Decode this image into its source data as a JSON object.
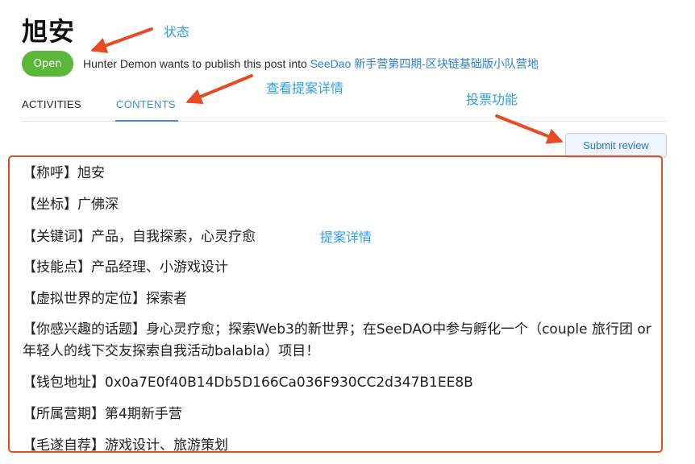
{
  "proposal": {
    "title": "旭安",
    "status": "Open",
    "author": "Hunter Demon",
    "publish_phrase": " wants to publish this post into ",
    "target": "SeeDao 新手营第四期-区块链基础版小队营地"
  },
  "tabs": [
    {
      "label": "ACTIVITIES",
      "active": false
    },
    {
      "label": "CONTENTS",
      "active": true
    }
  ],
  "actions": {
    "submit_review": "Submit review"
  },
  "content": {
    "fields": [
      "【称呼】旭安",
      "【坐标】广佛深",
      "【关键词】产品，自我探索，心灵疗愈",
      "【技能点】产品经理、小游戏设计",
      "【虚拟世界的定位】探索者",
      "【你感兴趣的话题】身心灵疗愈；探索Web3的新世界；在SeeDAO中参与孵化一个（couple 旅行团 or 年轻人的线下交友探索自我活动balabla）项目！",
      "【钱包地址】0x0a7E0f40B14Db5D166Ca036F930CC2d347B1EE8B",
      "【所属营期】第4期新手营",
      "【毛遂自荐】游戏设计、旅游策划"
    ]
  },
  "annotations": {
    "status": "状态",
    "view_details": "查看提案详情",
    "voting": "投票功能",
    "details": "提案详情"
  },
  "colors": {
    "status_green": "#5ab73a",
    "link_blue": "#2f7fd3",
    "tab_active": "#3b90d9",
    "annotation_red": "#e84b24",
    "annotation_text": "#2e9fe6"
  }
}
